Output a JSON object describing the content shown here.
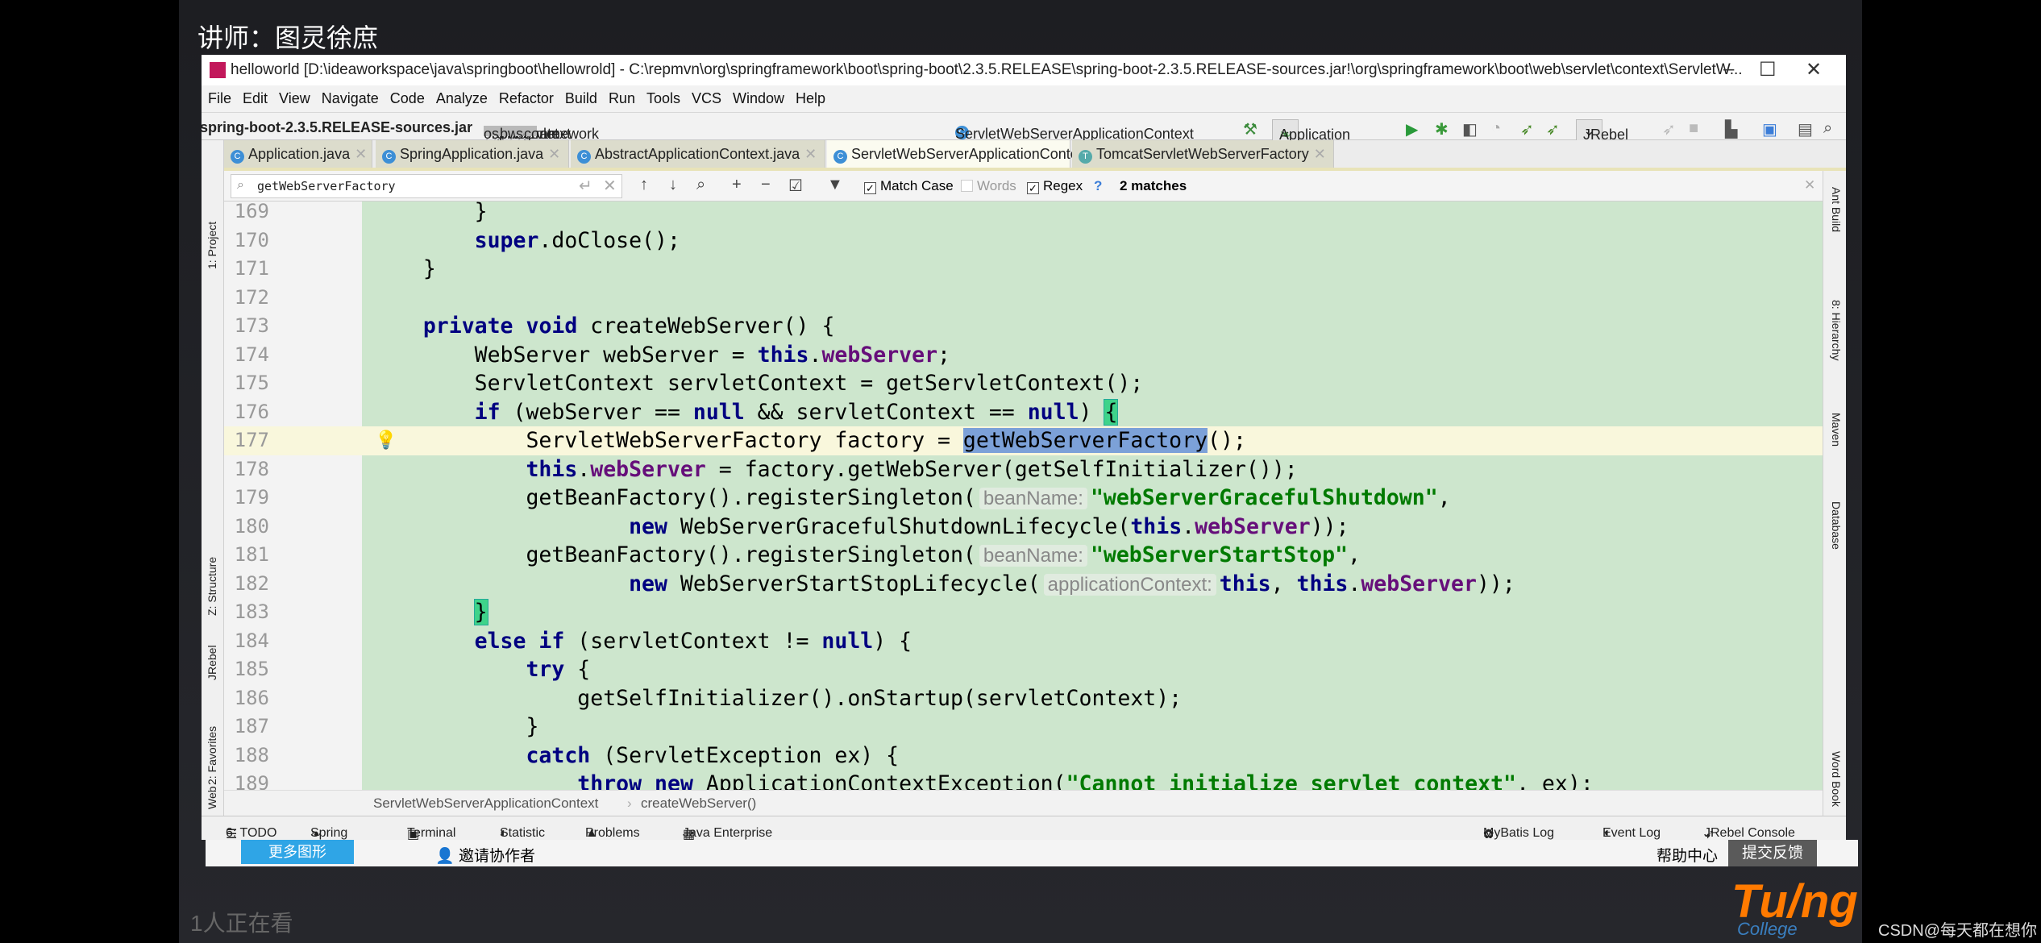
{
  "overlay": {
    "lecturer": "讲师：图灵徐庶",
    "viewers": "1人正在看",
    "logo_text": "Tu/ng",
    "logo_sub": "College",
    "watermark": "CSDN@每天都在想你"
  },
  "window": {
    "title": "helloworld [D:\\ideaworkspace\\java\\springboot\\hellowrold] - C:\\repmvn\\org\\springframework\\boot\\spring-boot\\2.3.5.RELEASE\\spring-boot-2.3.5.RELEASE-sources.jar!\\org\\springframework\\boot\\web\\servlet\\context\\ServletW...",
    "minimize": "–",
    "maximize": "☐",
    "close": "✕"
  },
  "menu": [
    "File",
    "Edit",
    "View",
    "Navigate",
    "Code",
    "Analyze",
    "Refactor",
    "Build",
    "Run",
    "Tools",
    "VCS",
    "Window",
    "Help"
  ],
  "nav": {
    "jar": "spring-boot-2.3.5.RELEASE-sources.jar",
    "packages": [
      "org",
      "springframework",
      "boot",
      "web",
      "servlet",
      "context"
    ],
    "class": "ServletWebServerApplicationContext",
    "class_icon": "C"
  },
  "toolbar": {
    "run_config": "Application",
    "jrebel": "JRebel"
  },
  "tabs": [
    {
      "label": "Application.java",
      "active": false
    },
    {
      "label": "SpringApplication.java",
      "active": false
    },
    {
      "label": "AbstractApplicationContext.java",
      "active": false
    },
    {
      "label": "ServletWebServerApplicationContext.java",
      "active": true
    },
    {
      "label": "TomcatServletWebServerFactory",
      "active": false
    }
  ],
  "find": {
    "query": "getWebServerFactory",
    "match_case_label": "Match Case",
    "match_case": true,
    "words_label": "Words",
    "words": false,
    "regex_label": "Regex",
    "regex": true,
    "help": "?",
    "matches": "2 matches"
  },
  "left_tools": [
    "1: Project",
    "Z: Structure",
    "JRebel",
    "2: Favorites",
    "Web"
  ],
  "right_tools": [
    "Ant Build",
    "8: Hierarchy",
    "Maven",
    "Database",
    "Word Book"
  ],
  "colors": {
    "editor_bg": "#cde6cd",
    "current_line": "#f9f7dc",
    "keyword": "#000080",
    "field": "#660e7a",
    "string": "#007a00",
    "match": "#7ca1d8"
  },
  "code": [
    {
      "n": "169",
      "indent": 8,
      "t": [
        [
          "p",
          "}"
        ]
      ]
    },
    {
      "n": "170",
      "indent": 8,
      "t": [
        [
          "k",
          "super"
        ],
        [
          "p",
          ".doClose();"
        ]
      ]
    },
    {
      "n": "171",
      "indent": 4,
      "t": [
        [
          "p",
          "}"
        ]
      ]
    },
    {
      "n": "172",
      "indent": 0,
      "t": []
    },
    {
      "n": "173",
      "indent": 4,
      "t": [
        [
          "k",
          "private"
        ],
        [
          "p",
          " "
        ],
        [
          "k",
          "void"
        ],
        [
          "p",
          " createWebServer() {"
        ]
      ]
    },
    {
      "n": "174",
      "indent": 8,
      "t": [
        [
          "p",
          "WebServer webServer = "
        ],
        [
          "k",
          "this"
        ],
        [
          "p",
          "."
        ],
        [
          "f",
          "webServer"
        ],
        [
          "p",
          ";"
        ]
      ]
    },
    {
      "n": "175",
      "indent": 8,
      "t": [
        [
          "p",
          "ServletContext servletContext = getServletContext();"
        ]
      ]
    },
    {
      "n": "176",
      "indent": 8,
      "t": [
        [
          "k",
          "if"
        ],
        [
          "p",
          " (webServer == "
        ],
        [
          "k",
          "null"
        ],
        [
          "p",
          " && servletContext == "
        ],
        [
          "k",
          "null"
        ],
        [
          "p",
          ") "
        ],
        [
          "b",
          "{"
        ]
      ]
    },
    {
      "n": "177",
      "indent": 12,
      "current": true,
      "t": [
        [
          "p",
          "ServletWebServerFactory factory = "
        ],
        [
          "m",
          "getWebServerFactory"
        ],
        [
          "p",
          "();"
        ]
      ]
    },
    {
      "n": "178",
      "indent": 12,
      "t": [
        [
          "k",
          "this"
        ],
        [
          "p",
          "."
        ],
        [
          "f",
          "webServer"
        ],
        [
          "p",
          " = factory.getWebServer(getSelfInitializer());"
        ]
      ]
    },
    {
      "n": "179",
      "indent": 12,
      "t": [
        [
          "p",
          "getBeanFactory().registerSingleton("
        ],
        [
          "h",
          "beanName:"
        ],
        [
          "s",
          "\"webServerGracefulShutdown\""
        ],
        [
          "p",
          ","
        ]
      ]
    },
    {
      "n": "180",
      "indent": 20,
      "t": [
        [
          "k",
          "new"
        ],
        [
          "p",
          " WebServerGracefulShutdownLifecycle("
        ],
        [
          "k",
          "this"
        ],
        [
          "p",
          "."
        ],
        [
          "f",
          "webServer"
        ],
        [
          "p",
          "));"
        ]
      ]
    },
    {
      "n": "181",
      "indent": 12,
      "t": [
        [
          "p",
          "getBeanFactory().registerSingleton("
        ],
        [
          "h",
          "beanName:"
        ],
        [
          "s",
          "\"webServerStartStop\""
        ],
        [
          "p",
          ","
        ]
      ]
    },
    {
      "n": "182",
      "indent": 20,
      "t": [
        [
          "k",
          "new"
        ],
        [
          "p",
          " WebServerStartStopLifecycle("
        ],
        [
          "h",
          "applicationContext:"
        ],
        [
          "k",
          "this"
        ],
        [
          "p",
          ", "
        ],
        [
          "k",
          "this"
        ],
        [
          "p",
          "."
        ],
        [
          "f",
          "webServer"
        ],
        [
          "p",
          "));"
        ]
      ]
    },
    {
      "n": "183",
      "indent": 8,
      "t": [
        [
          "b",
          "}"
        ]
      ]
    },
    {
      "n": "184",
      "indent": 8,
      "t": [
        [
          "k",
          "else if"
        ],
        [
          "p",
          " (servletContext != "
        ],
        [
          "k",
          "null"
        ],
        [
          "p",
          ") {"
        ]
      ]
    },
    {
      "n": "185",
      "indent": 12,
      "t": [
        [
          "k",
          "try"
        ],
        [
          "p",
          " {"
        ]
      ]
    },
    {
      "n": "186",
      "indent": 16,
      "t": [
        [
          "p",
          "getSelfInitializer().onStartup(servletContext);"
        ]
      ]
    },
    {
      "n": "187",
      "indent": 12,
      "t": [
        [
          "p",
          "}"
        ]
      ]
    },
    {
      "n": "188",
      "indent": 12,
      "t": [
        [
          "k",
          "catch"
        ],
        [
          "p",
          " (ServletException ex) {"
        ]
      ]
    },
    {
      "n": "189",
      "indent": 16,
      "t": [
        [
          "k",
          "throw"
        ],
        [
          "p",
          " "
        ],
        [
          "k",
          "new"
        ],
        [
          "p",
          " ApplicationContextException("
        ],
        [
          "s",
          "\"Cannot initialize servlet context\""
        ],
        [
          "p",
          ", ex);"
        ]
      ]
    }
  ],
  "breadcrumb": [
    "ServletWebServerApplicationContext",
    "createWebServer()"
  ],
  "bottom_tools_left": [
    "6: TODO",
    "Spring",
    "Terminal",
    "Statistic",
    "Problems",
    "Java Enterprise"
  ],
  "bottom_tools_right": [
    "MyBatis Log",
    "Event Log",
    "JRebel Console"
  ],
  "appbar": {
    "more": "更多图形",
    "invite": "邀请协作者",
    "help": "帮助中心",
    "feedback": "提交反馈"
  }
}
